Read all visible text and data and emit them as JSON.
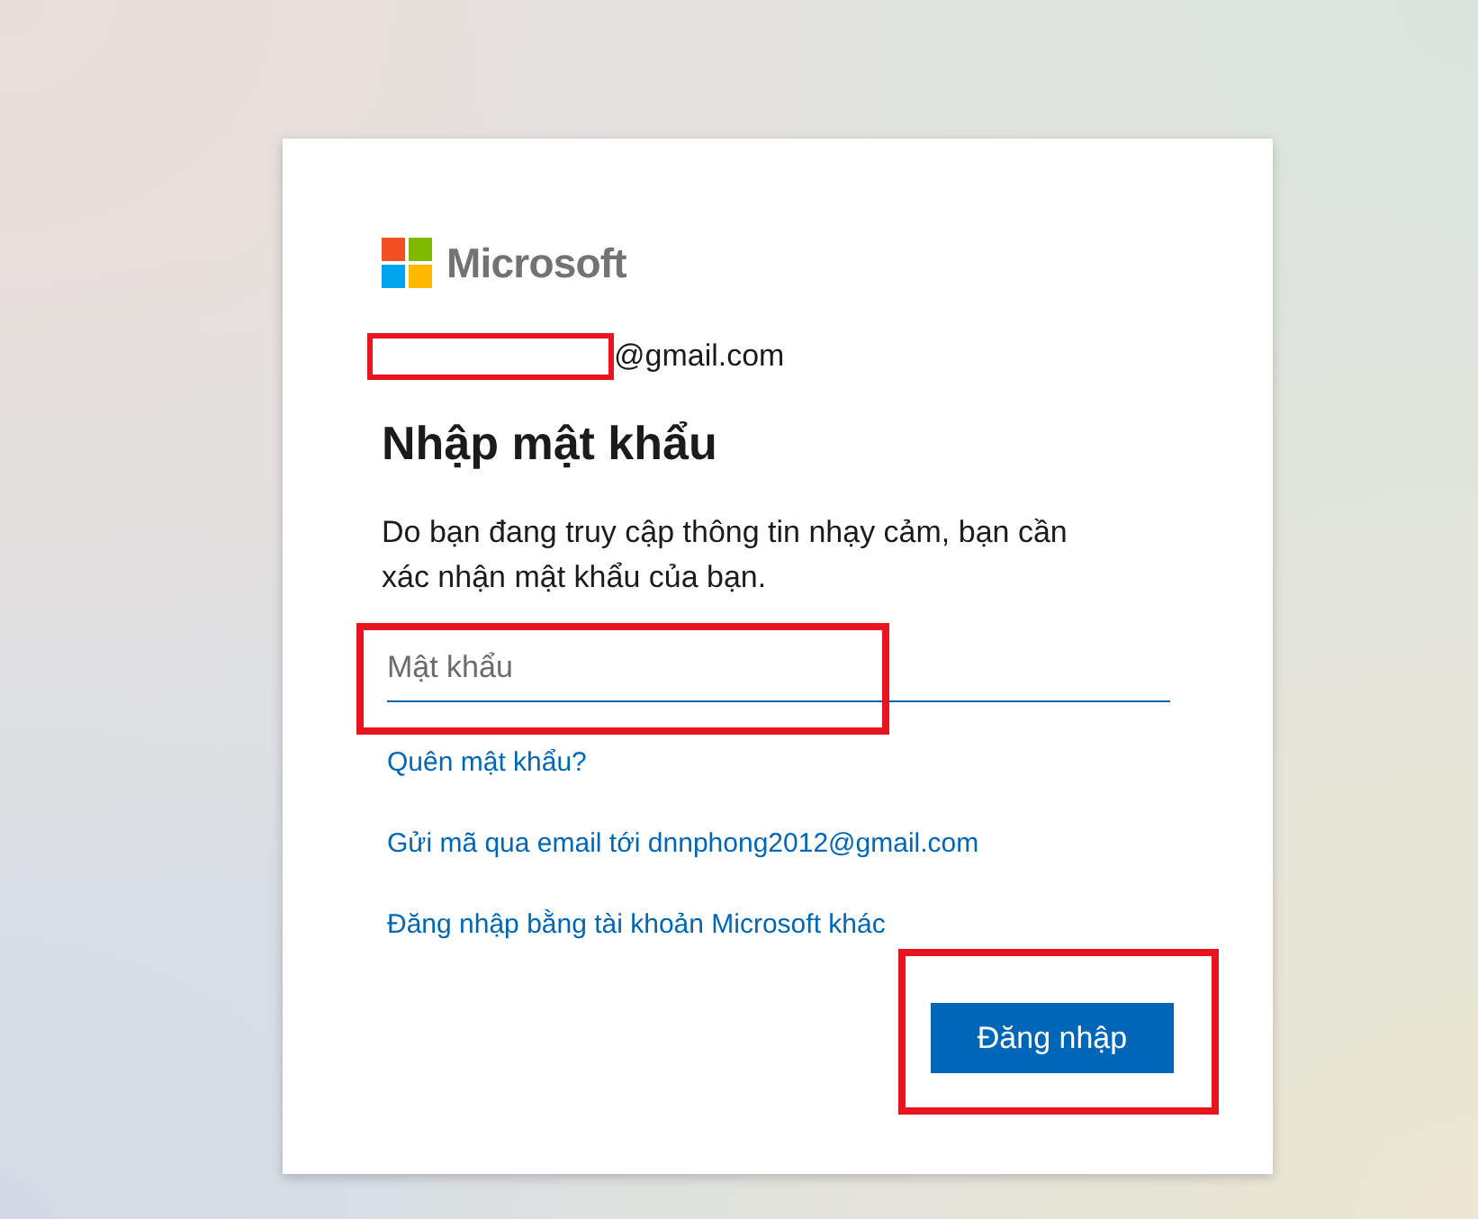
{
  "logo": {
    "text": "Microsoft"
  },
  "account": {
    "redacted": true,
    "text": "@gmail.com"
  },
  "heading": "Nhập mật khẩu",
  "description": "Do bạn đang truy cập thông tin nhạy cảm, bạn cần xác nhận mật khẩu của bạn.",
  "password_field": {
    "placeholder": "Mật khẩu",
    "focused": true,
    "highlighted": true
  },
  "links": [
    "Quên mật khẩu?",
    "Gửi mã qua email tới dnnphong2012@gmail.com",
    "Đăng nhập bằng tài khoản Microsoft khác"
  ],
  "submit_button": {
    "label": "Đăng nhập",
    "highlighted": true
  }
}
